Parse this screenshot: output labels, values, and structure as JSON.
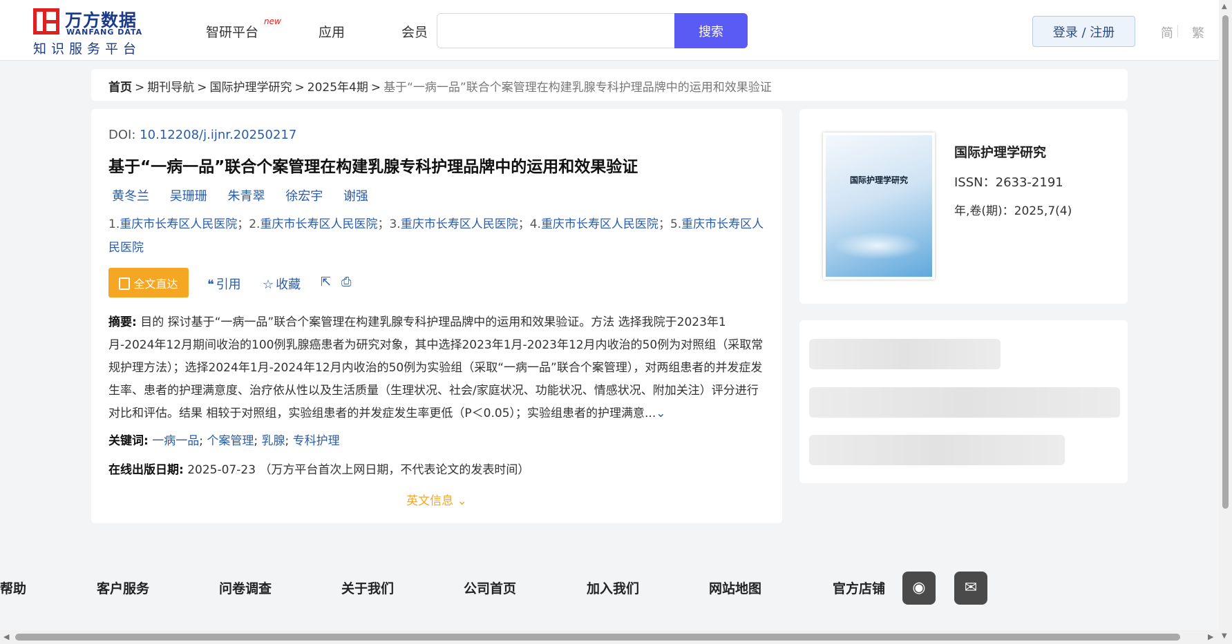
{
  "logo": {
    "cn": "万方数据",
    "en": "WANFANG DATA",
    "sub": "知识服务平台"
  },
  "nav": {
    "items": [
      "智研平台",
      "应用",
      "会员"
    ],
    "new_badge": "new"
  },
  "search": {
    "value": "",
    "placeholder": "",
    "button": "搜索"
  },
  "login": "登录 / 注册",
  "lang": {
    "simplified": "简",
    "traditional": "繁"
  },
  "breadcrumb": [
    "首页",
    "期刊导航",
    "国际护理学研究",
    "2025年4期",
    "基于“一病一品”联合个案管理在构建乳腺专科护理品牌中的运用和效果验证"
  ],
  "article": {
    "doi_label": "DOI:",
    "doi": "10.12208/j.ijnr.20250217",
    "title": "基于“一病一品”联合个案管理在构建乳腺专科护理品牌中的运用和效果验证",
    "authors": [
      "黄冬兰",
      "吴珊珊",
      "朱青翠",
      "徐宏宇",
      "谢强"
    ],
    "affiliations": [
      {
        "num": "1.",
        "name": "重庆市长寿区人民医院"
      },
      {
        "num": "2.",
        "name": "重庆市长寿区人民医院"
      },
      {
        "num": "3.",
        "name": "重庆市长寿区人民医院"
      },
      {
        "num": "4.",
        "name": "重庆市长寿区人民医院"
      },
      {
        "num": "5.",
        "name": "重庆市长寿区人民医院"
      }
    ],
    "fulltext_button": "全文直达",
    "actions": {
      "cite": "引用",
      "favorite": "收藏"
    },
    "abstract_label": "摘要:",
    "abstract": "目的 探讨基于“一病一品”联合个案管理在构建乳腺专科护理品牌中的运用和效果验证。方法 选择我院于2023年1月-2024年12月期间收治的100例乳腺癌患者为研究对象，其中选择2023年1月-2023年12月内收治的50例为对照组（采取常规护理方法）；选择2024年1月-2024年12月内收治的50例为实验组（采取“一病一品”联合个案管理），对两组患者的并发症发生率、患者的护理满意度、治疗依从性以及生活质量（生理状况、社会/家庭状况、功能状况、情感状况、附加关注）评分进行对比和评估。结果 相较于对照组，实验组患者的并发症发生率更低（P＜0.05）；实验组患者的护理满意...",
    "keywords_label": "关键词:",
    "keywords": [
      "一病一品",
      "个案管理",
      "乳腺",
      "专科护理"
    ],
    "pubdate_label": "在线出版日期:",
    "pubdate": "2025-07-23",
    "pubdate_note": "（万方平台首次上网日期，不代表论文的发表时间）",
    "english_info": "英文信息"
  },
  "journal": {
    "cover_title": "国际护理学研究",
    "name": "国际护理学研究",
    "issn": "ISSN：2633-2191",
    "volume": "年,卷(期)：2025,7(4)"
  },
  "footer": {
    "links": [
      "帮助",
      "客户服务",
      "问卷调查",
      "关于我们",
      "公司首页",
      "加入我们",
      "网站地图",
      "官方店铺"
    ]
  },
  "icons": [
    "search-icon",
    "quote-icon",
    "star-icon",
    "share-icon",
    "print-icon",
    "chevron-down-icon",
    "weibo-icon",
    "wechat-icon"
  ],
  "colors": {
    "accent": "#5a5af5",
    "link": "#2a5ca8",
    "orange": "#f5a623",
    "brand_red": "#e02020",
    "brand_blue": "#1b3a8a"
  }
}
